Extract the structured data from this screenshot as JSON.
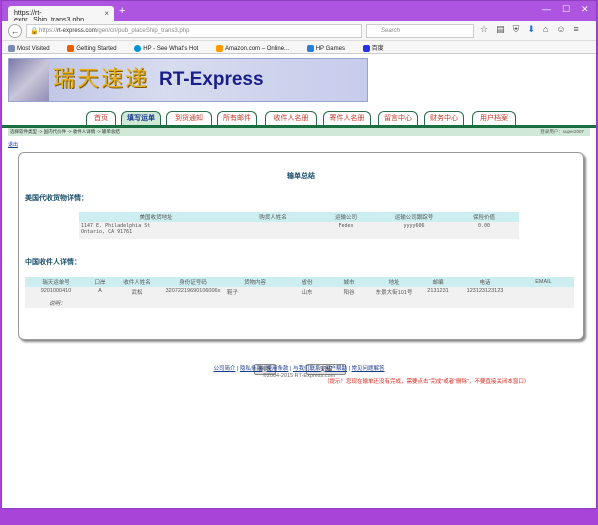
{
  "browser": {
    "tab_title": "https://rt-expr...Ship_trans3.php",
    "tab_close": "×",
    "new_tab": "+",
    "url_prefix": "https://",
    "url_domain": "rt-express.com",
    "url_path": "/gen/cn/pub_placeShip_trans3.php",
    "search_placeholder": "Search",
    "bookmarks": [
      "Most Visited",
      "Getting Started",
      "HP - See What's Hot",
      "Amazon.com – Online...",
      "HP Games",
      "百度"
    ]
  },
  "banner": {
    "cn": "瑞天速递",
    "en": "RT-Express"
  },
  "nav": {
    "tabs": [
      "首页",
      "填写运单",
      "到货通知",
      "所有邮件",
      "收件人名册",
      "寄件人名册",
      "留言中心",
      "财务中心",
      "用户档案"
    ],
    "active": 1
  },
  "breadcrumb": "选择软件类型 -> 国内代价件 -> 收件人详情 -> 输单总结",
  "user_label": "登录用户：super2007",
  "back_link": "退出",
  "summary": {
    "title": "输单总结",
    "us_section": "美国代收货物详情：",
    "us_headers": [
      "美国收货地址",
      "购货人姓名",
      "运输公司",
      "运输公司跟踪号",
      "保险价值"
    ],
    "us_row": {
      "address_line1": "1147 E. Philadelphia St",
      "address_line2": "Ontario, CA 91761",
      "buyer": "",
      "carrier": "Fedex",
      "tracking": "yyyy606",
      "insurance": "0.00"
    },
    "cn_section": "中国收件人详情：",
    "cn_headers": [
      "瑞天运单号",
      "口岸",
      "收件人姓名",
      "身份证号码",
      "货物内容",
      "省份",
      "城市",
      "地址",
      "邮编",
      "电话",
      "EMAIL"
    ],
    "cn_row": [
      "9201000410",
      "A",
      "武松",
      "32072219690106006x",
      "鞋子",
      "山东",
      "阳谷",
      "东景大街101号",
      "2131231",
      "123123123123",
      ""
    ],
    "note_label": "说明：",
    "delete_button": "删除",
    "finish_button": "完成",
    "hint": "（提示！您现在输单还没有完成，需要点击“完成”或者“删除”，不要直接关闭本窗口）"
  },
  "footer": {
    "links": [
      "公司简介",
      "隐私条款",
      "使用条款",
      "与我们联系",
      "用户帮助",
      "常见问题解答"
    ],
    "copyright": "©2004-2015 RT-Express.com"
  },
  "colors": {
    "accent": "#1b6e3f",
    "tab_active": "#cfe9d6",
    "header_cell": "#cdeef0",
    "hint": "#d7291e"
  }
}
